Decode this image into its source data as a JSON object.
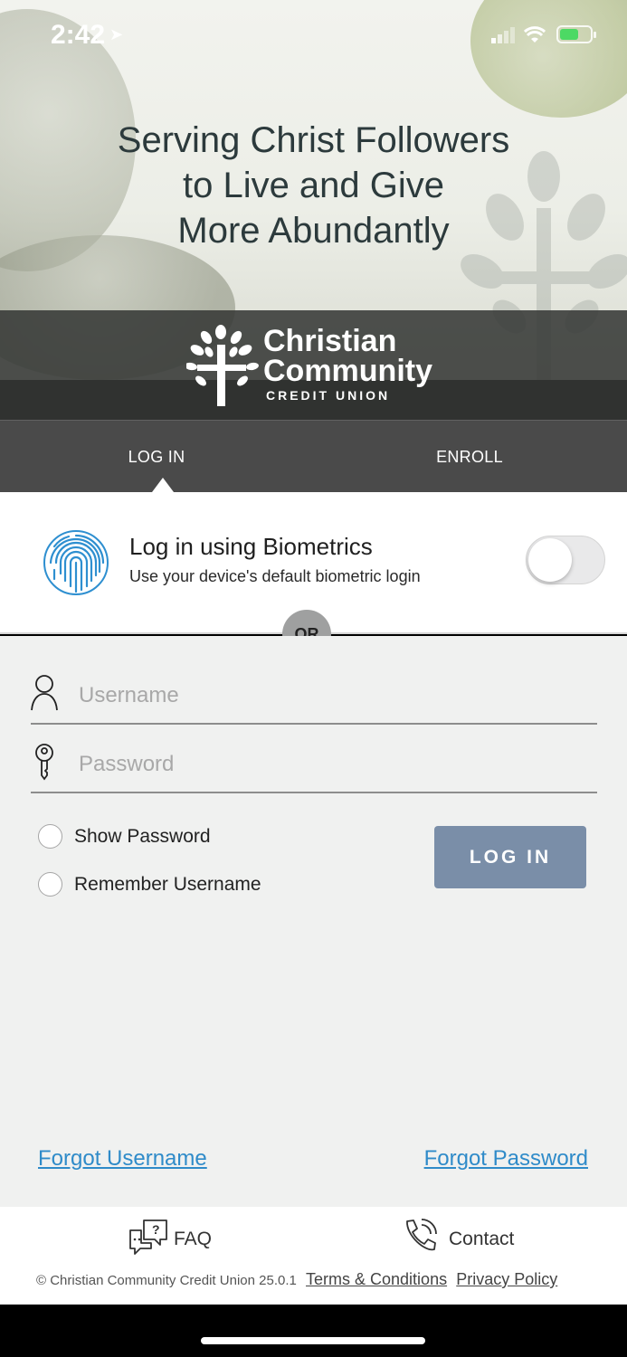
{
  "status_bar": {
    "time": "2:42"
  },
  "hero": {
    "tagline_lines": [
      "Serving Christ Followers",
      "to Live and Give",
      "More Abundantly"
    ]
  },
  "brand": {
    "name_line1": "Christian",
    "name_line2": "Community",
    "sub": "CREDIT UNION"
  },
  "tabs": {
    "login": "LOG IN",
    "enroll": "ENROLL",
    "active": "login"
  },
  "biometrics": {
    "title": "Log in using Biometrics",
    "subtitle": "Use your device's default biometric login",
    "enabled": false
  },
  "divider": {
    "or": "OR"
  },
  "form": {
    "username_placeholder": "Username",
    "username_value": "",
    "password_placeholder": "Password",
    "password_value": "",
    "show_password": "Show Password",
    "remember_username": "Remember Username",
    "login_button": "LOG IN"
  },
  "links": {
    "forgot_username": "Forgot Username",
    "forgot_password": "Forgot Password"
  },
  "footer": {
    "faq": "FAQ",
    "contact": "Contact",
    "copyright": "© Christian Community Credit Union 25.0.1",
    "terms": "Terms & Conditions",
    "privacy": "Privacy Policy"
  },
  "colors": {
    "accent_link": "#2f8bc9",
    "login_button": "#7a8ea8",
    "tab_bar": "#4a4a4a",
    "fingerprint": "#2e8fd0"
  }
}
